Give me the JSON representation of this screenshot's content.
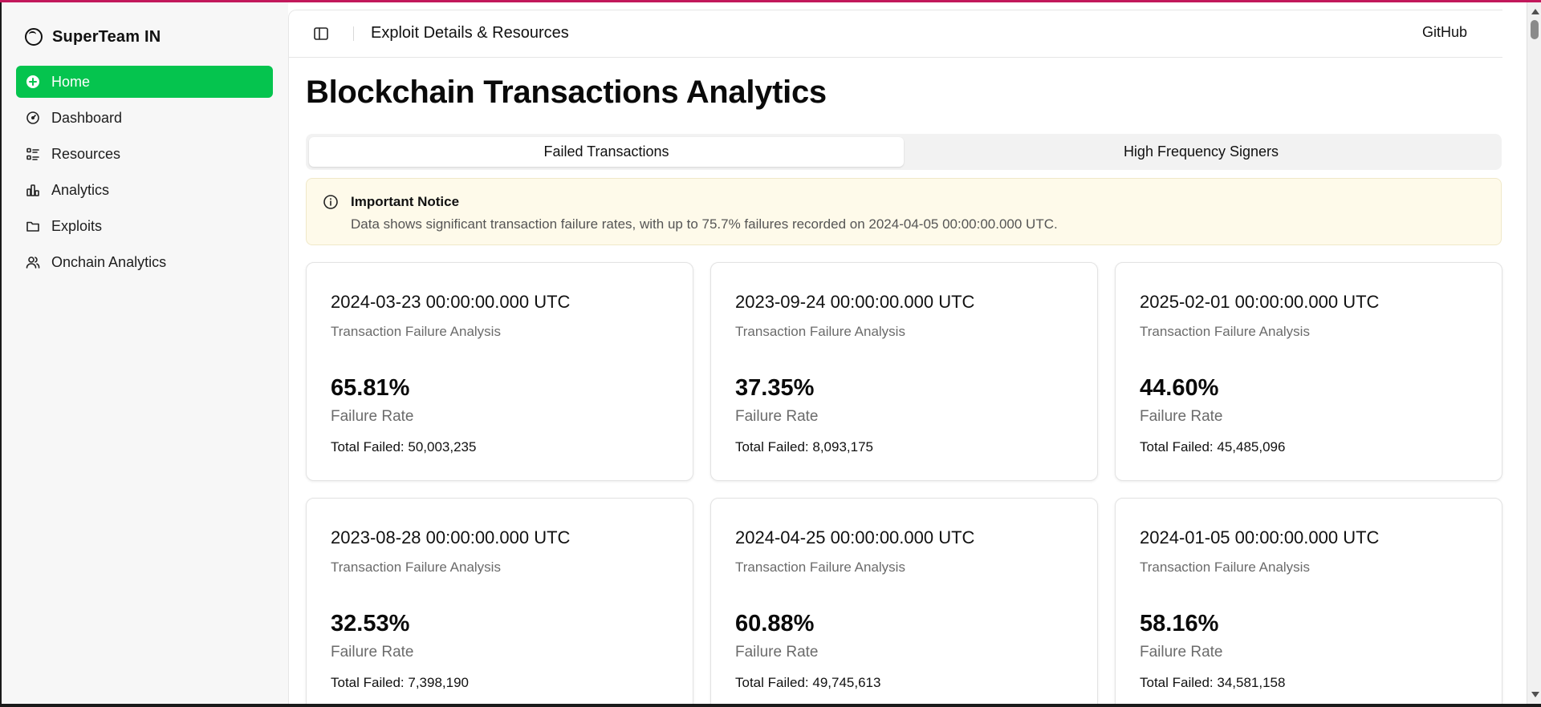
{
  "brand": {
    "name": "SuperTeam IN"
  },
  "sidebar": {
    "items": [
      {
        "label": "Home",
        "icon": "plus-circle-icon",
        "active": true
      },
      {
        "label": "Dashboard",
        "icon": "gauge-icon",
        "active": false
      },
      {
        "label": "Resources",
        "icon": "list-icon",
        "active": false
      },
      {
        "label": "Analytics",
        "icon": "bar-chart-icon",
        "active": false
      },
      {
        "label": "Exploits",
        "icon": "folder-icon",
        "active": false
      },
      {
        "label": "Onchain Analytics",
        "icon": "users-icon",
        "active": false
      }
    ]
  },
  "header": {
    "title": "Exploit Details & Resources",
    "github_label": "GitHub"
  },
  "page": {
    "title": "Blockchain Transactions Analytics"
  },
  "tabs": [
    {
      "label": "Failed Transactions",
      "active": true
    },
    {
      "label": "High Frequency Signers",
      "active": false
    }
  ],
  "notice": {
    "title": "Important Notice",
    "text": "Data shows significant transaction failure rates, with up to 75.7% failures recorded on 2024-04-05 00:00:00.000 UTC."
  },
  "cards": [
    {
      "date": "2024-03-23 00:00:00.000 UTC",
      "subtitle": "Transaction Failure Analysis",
      "rate": "65.81%",
      "rate_label": "Failure Rate",
      "total": "Total Failed: 50,003,235"
    },
    {
      "date": "2023-09-24 00:00:00.000 UTC",
      "subtitle": "Transaction Failure Analysis",
      "rate": "37.35%",
      "rate_label": "Failure Rate",
      "total": "Total Failed: 8,093,175"
    },
    {
      "date": "2025-02-01 00:00:00.000 UTC",
      "subtitle": "Transaction Failure Analysis",
      "rate": "44.60%",
      "rate_label": "Failure Rate",
      "total": "Total Failed: 45,485,096"
    },
    {
      "date": "2023-08-28 00:00:00.000 UTC",
      "subtitle": "Transaction Failure Analysis",
      "rate": "32.53%",
      "rate_label": "Failure Rate",
      "total": "Total Failed: 7,398,190"
    },
    {
      "date": "2024-04-25 00:00:00.000 UTC",
      "subtitle": "Transaction Failure Analysis",
      "rate": "60.88%",
      "rate_label": "Failure Rate",
      "total": "Total Failed: 49,745,613"
    },
    {
      "date": "2024-01-05 00:00:00.000 UTC",
      "subtitle": "Transaction Failure Analysis",
      "rate": "58.16%",
      "rate_label": "Failure Rate",
      "total": "Total Failed: 34,581,158"
    }
  ],
  "colors": {
    "accent_green": "#05c44e",
    "notice_bg": "#fefaea",
    "top_accent": "#c2185b"
  }
}
